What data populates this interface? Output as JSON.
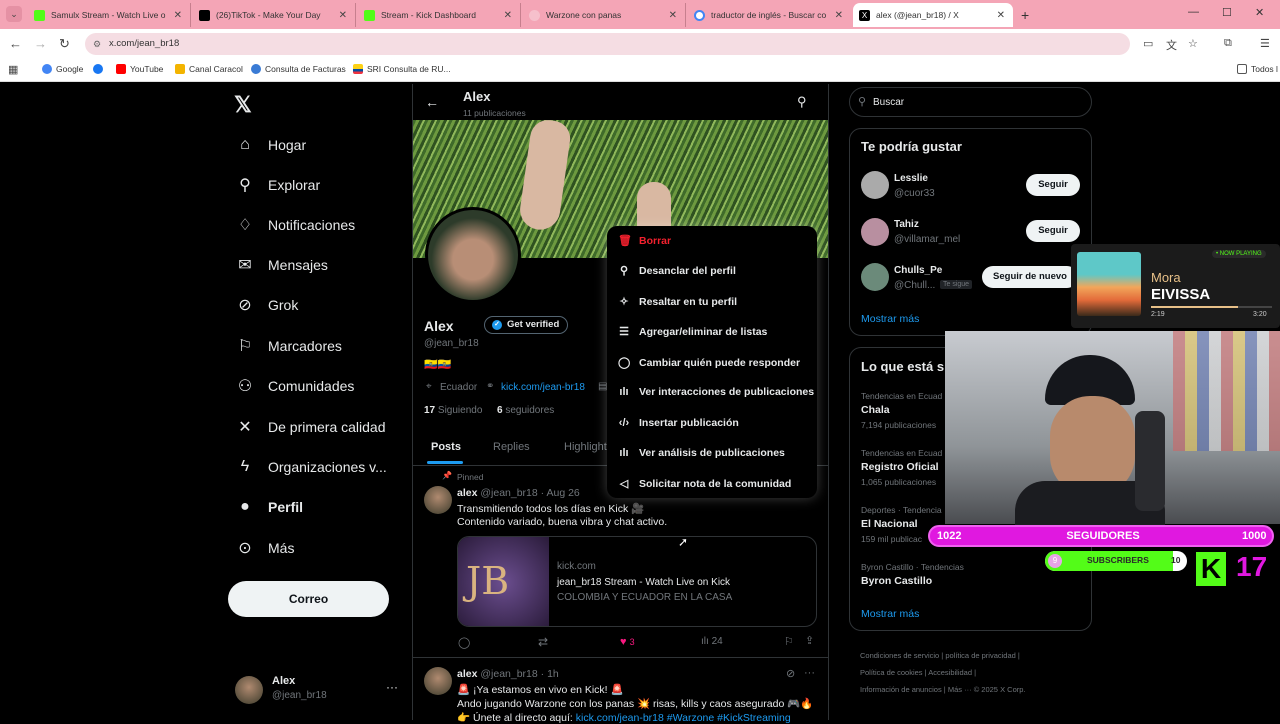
{
  "browser": {
    "tabs": [
      {
        "title": "Samulx Stream - Watch Live on",
        "color": "#53fc18"
      },
      {
        "title": "(26)TikTok - Make Your Day",
        "color": "#000000"
      },
      {
        "title": "Stream - Kick Dashboard",
        "color": "#53fc18"
      },
      {
        "title": "Warzone con panas",
        "color": "#f6c0cc"
      },
      {
        "title": "traductor de inglés - Buscar con",
        "color": "#ffffff"
      },
      {
        "title": "alex (@jean_br18) / X",
        "color": "#000000"
      }
    ],
    "url": "x.com/jean_br18",
    "bookmarks": [
      "Google",
      "YouTube",
      "Canal Caracol",
      "Consulta de Facturas",
      "SRI Consulta de RU...",
      "Todos l"
    ]
  },
  "nav": {
    "items": [
      "Hogar",
      "Explorar",
      "Notificaciones",
      "Mensajes",
      "Grok",
      "Marcadores",
      "Comunidades",
      "De primera calidad",
      "Organizaciones v...",
      "Perfil",
      "Más"
    ],
    "post_button": "Correo",
    "account_name": "Alex",
    "account_handle": "@jean_br18"
  },
  "profile": {
    "header_name": "Alex",
    "post_count": "11 publicaciones",
    "name": "Alex",
    "verify_label": "Get verified",
    "handle": "@jean_br18",
    "flags": "🇪🇨🇪🇨",
    "location": "Ecuador",
    "link": "kick.com/jean-br18",
    "following_count": "17",
    "following_label": "Siguiendo",
    "followers_count": "6",
    "followers_label": "seguidores",
    "tabs": [
      "Posts",
      "Replies",
      "Highlight"
    ]
  },
  "menu": {
    "items": [
      "Borrar",
      "Desanclar del perfil",
      "Resaltar en tu perfil",
      "Agregar/eliminar de listas",
      "Cambiar quién puede responder",
      "Ver interacciones de publicaciones",
      "Insertar publicación",
      "Ver análisis de publicaciones",
      "Solicitar nota de la comunidad"
    ]
  },
  "posts": [
    {
      "pinned": "Pinned",
      "name": "alex",
      "handle": "@jean_br18",
      "time": "· Aug 26",
      "line1": "Transmitiendo todos los días en Kick 🎥",
      "line2": "Contenido variado, buena vibra y chat activo.",
      "card_domain": "kick.com",
      "card_title": "jean_br18 Stream - Watch Live on Kick",
      "card_desc": "COLOMBIA Y ECUADOR EN LA CASA",
      "card_logo": "JB",
      "likes": "3",
      "views": "24"
    },
    {
      "name": "alex",
      "handle": "@jean_br18",
      "time": "· 1h",
      "line1": "🚨 ¡Ya estamos en vivo en Kick! 🚨",
      "line2": "Ando jugando Warzone con los panas 💥 risas, kills y caos asegurado 🎮🔥",
      "line3_prefix": "👉 Únete al directo aquí: ",
      "line3_link": "kick.com/jean-br18 #Warzone #KickStreaming"
    }
  ],
  "search": {
    "placeholder": "Buscar"
  },
  "suggestions": {
    "title": "Te podría gustar",
    "users": [
      {
        "name": "Lesslie",
        "handle": "@cuor33",
        "button": "Seguir"
      },
      {
        "name": "Tahiz",
        "handle": "@villamar_mel",
        "button": "Seguir"
      },
      {
        "name": "Chulls_Pe",
        "handle": "@Chull...",
        "badge": "Te sigue",
        "button": "Seguir de nuevo"
      }
    ],
    "more": "Mostrar más"
  },
  "trends": {
    "title": "Lo que está s",
    "items": [
      {
        "ctx": "Tendencias en Ecuad",
        "name": "Chala",
        "count": "7,194 publicaciones"
      },
      {
        "ctx": "Tendencias en Ecuad",
        "name": "Registro Oficial",
        "count": "1,065 publicaciones"
      },
      {
        "ctx": "Deportes · Tendencia",
        "name": "El Nacional",
        "count": "159 mil publicac"
      },
      {
        "ctx": "Byron Castillo · Tendencias",
        "name": "Byron Castillo",
        "count": ""
      }
    ],
    "more": "Mostrar más"
  },
  "footer": [
    "Condiciones de servicio",
    "política de privacidad",
    "Política de cookies",
    "Accesibilidad",
    "Información de anuncios",
    "Más ···",
    "© 2025 X Corp."
  ],
  "overlay": {
    "now_playing": "• NOW PLAYING",
    "artist": "Mora",
    "song": "EIVISSA",
    "t_start": "2:19",
    "t_end": "3:20",
    "progress": 0.72,
    "followers_current": "1022",
    "followers_label": "SEGUIDORES",
    "followers_goal": "1000",
    "subs_current": "9",
    "subs_label": "SUBSCRIBERS",
    "subs_goal": "10",
    "subs_progress": 0.9,
    "kick_count": "17",
    "kick_logo": "K"
  }
}
